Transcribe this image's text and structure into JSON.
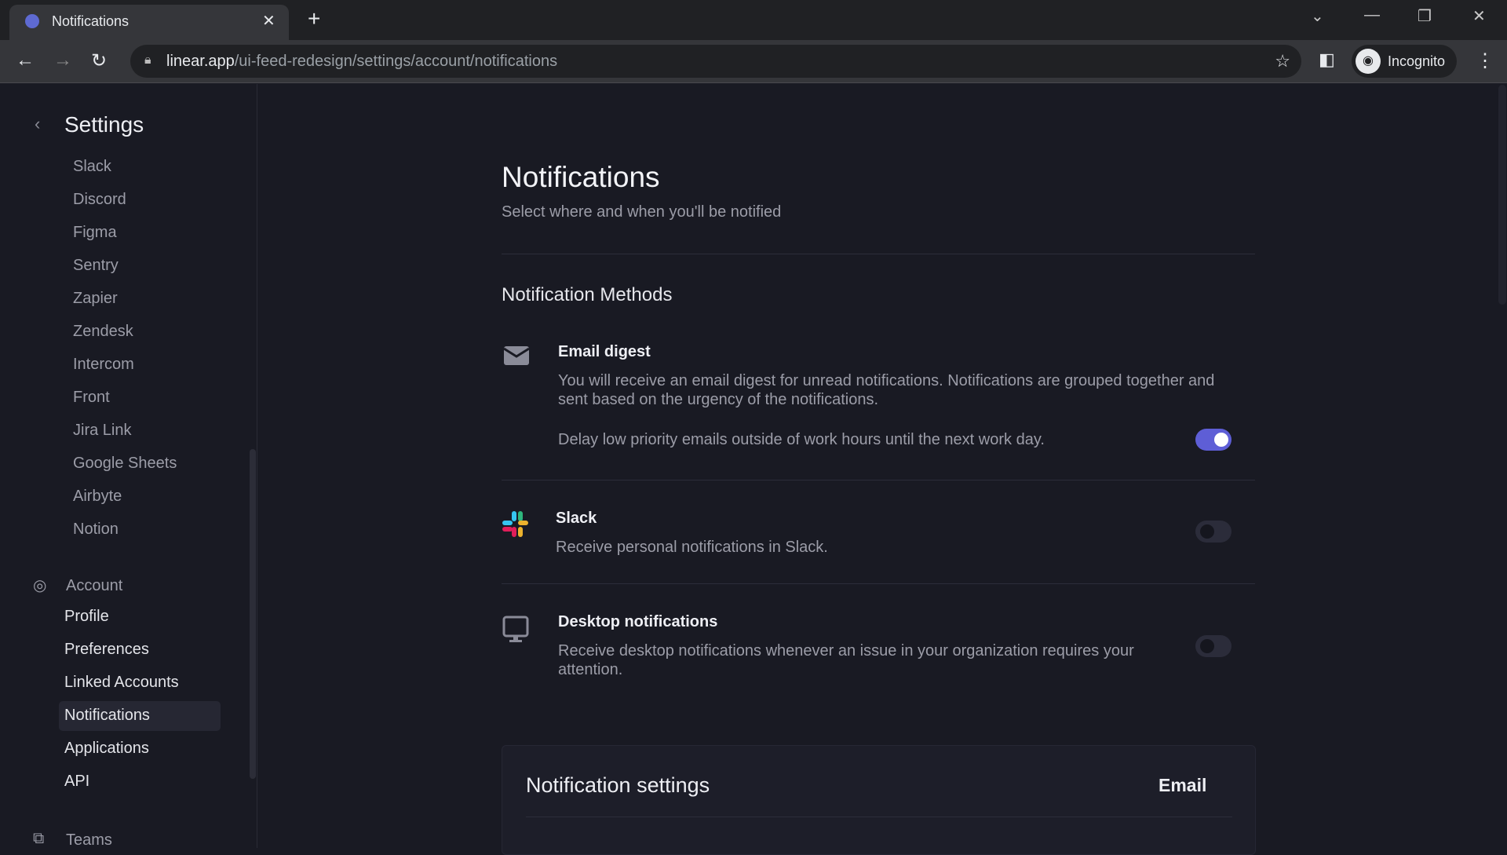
{
  "browser": {
    "tab_title": "Notifications",
    "url_host": "linear.app",
    "url_path": "/ui-feed-redesign/settings/account/notifications",
    "profile": "Incognito"
  },
  "sidebar": {
    "title": "Settings",
    "integrations": [
      "Slack",
      "Discord",
      "Figma",
      "Sentry",
      "Zapier",
      "Zendesk",
      "Intercom",
      "Front",
      "Jira Link",
      "Google Sheets",
      "Airbyte",
      "Notion"
    ],
    "account_header": "Account",
    "account_items": [
      "Profile",
      "Preferences",
      "Linked Accounts",
      "Notifications",
      "Applications",
      "API"
    ],
    "active_item": "Notifications",
    "teams_header": "Teams"
  },
  "main": {
    "title": "Notifications",
    "subtitle": "Select where and when you'll be notified",
    "methods_header": "Notification Methods",
    "methods": [
      {
        "icon": "envelope-icon",
        "title": "Email digest",
        "desc": "You will receive an email digest for unread notifications. Notifications are grouped together and sent based on the urgency of the notifications.",
        "option": "Delay low priority emails outside of work hours until the next work day.",
        "enabled": true
      },
      {
        "icon": "slack-icon",
        "title": "Slack",
        "desc": "Receive personal notifications in Slack.",
        "enabled": false
      },
      {
        "icon": "monitor-icon",
        "title": "Desktop notifications",
        "desc": "Receive desktop notifications whenever an issue in your organization requires your attention.",
        "enabled": false
      }
    ],
    "settings_card": {
      "title": "Notification settings",
      "column": "Email"
    }
  },
  "colors": {
    "accent": "#5e5ed6",
    "background": "#191a23"
  }
}
